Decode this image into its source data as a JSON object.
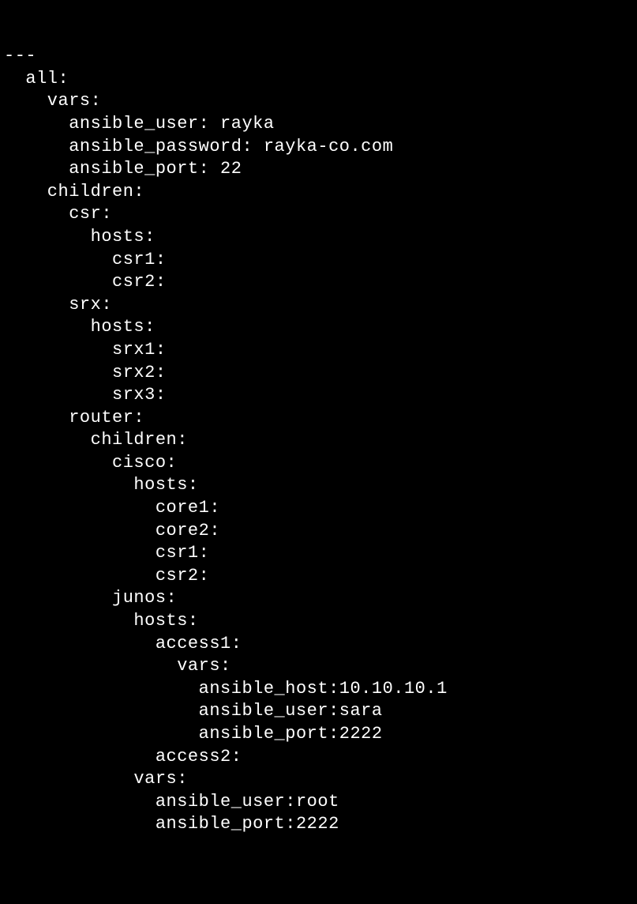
{
  "lines": {
    "l0": "---",
    "l1": "  all:",
    "l2": "    vars:",
    "l3": "      ansible_user: rayka",
    "l4": "      ansible_password: rayka-co.com",
    "l5": "      ansible_port: 22",
    "l6": "    children:",
    "l7": "      csr:",
    "l8": "        hosts:",
    "l9": "          csr1:",
    "l10": "          csr2:",
    "l11": "      srx:",
    "l12": "        hosts:",
    "l13": "          srx1:",
    "l14": "          srx2:",
    "l15": "          srx3:",
    "l16": "      router:",
    "l17": "        children:",
    "l18": "          cisco:",
    "l19": "            hosts:",
    "l20": "              core1:",
    "l21": "              core2:",
    "l22": "              csr1:",
    "l23": "              csr2:",
    "l24": "          junos:",
    "l25": "            hosts:",
    "l26": "              access1:",
    "l27": "                vars:",
    "l28": "                  ansible_host:10.10.10.1",
    "l29": "                  ansible_user:sara",
    "l30": "                  ansible_port:2222",
    "l31": "              access2:",
    "l32": "            vars:",
    "l33": "              ansible_user:root",
    "l34": "              ansible_port:2222"
  }
}
